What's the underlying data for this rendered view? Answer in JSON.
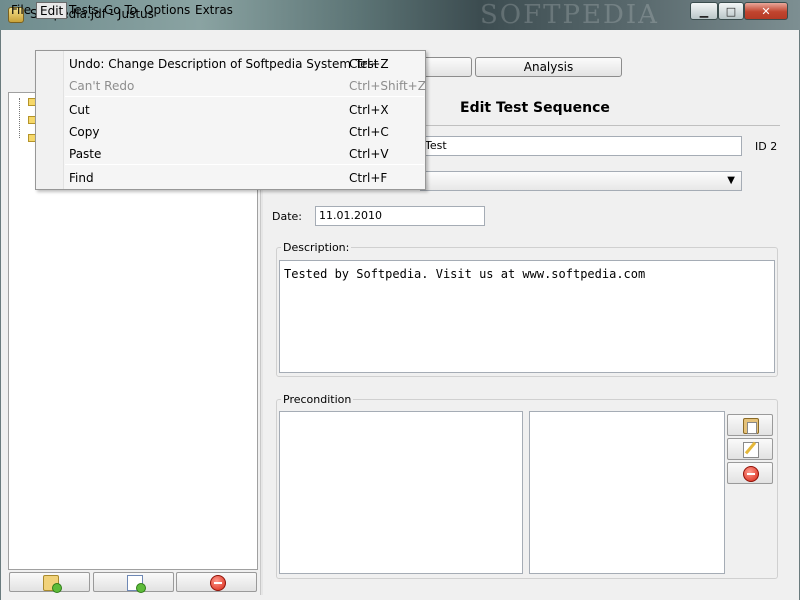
{
  "window": {
    "title": "Softpedia.jdf - Justus",
    "watermark": "SOFTPEDIA",
    "minimize_glyph": "▁",
    "maximize_glyph": "□",
    "close_glyph": "✕"
  },
  "menubar": [
    "File",
    "Edit",
    "Tests",
    "Go To",
    "Options",
    "Extras"
  ],
  "edit_menu": {
    "items": [
      {
        "label": "Undo: Change Description of Softpedia System Test",
        "shortcut": "Ctrl+Z",
        "enabled": true
      },
      {
        "label": "Can't Redo",
        "shortcut": "Ctrl+Shift+Z",
        "enabled": false
      },
      {
        "label": "Cut",
        "shortcut": "Ctrl+X",
        "enabled": true
      },
      {
        "label": "Copy",
        "shortcut": "Ctrl+C",
        "enabled": true
      },
      {
        "label": "Paste",
        "shortcut": "Ctrl+V",
        "enabled": true
      },
      {
        "label": "Find",
        "shortcut": "Ctrl+F",
        "enabled": true
      }
    ]
  },
  "tabs": {
    "analysis": "Analysis"
  },
  "editor": {
    "heading": "Edit Test Sequence",
    "name_value": "Test",
    "id_label": "ID 2",
    "date_label": "Date:",
    "date_value": "11.01.2010",
    "description_label": "Description:",
    "description_value": "Tested by Softpedia. Visit us at www.softpedia.com",
    "precondition_label": "Precondition"
  },
  "icons": {
    "left_buttons": [
      "add-folder-icon",
      "add-document-icon",
      "remove-icon"
    ],
    "precondition_buttons": [
      "paste-icon",
      "edit-icon",
      "remove-icon"
    ]
  }
}
